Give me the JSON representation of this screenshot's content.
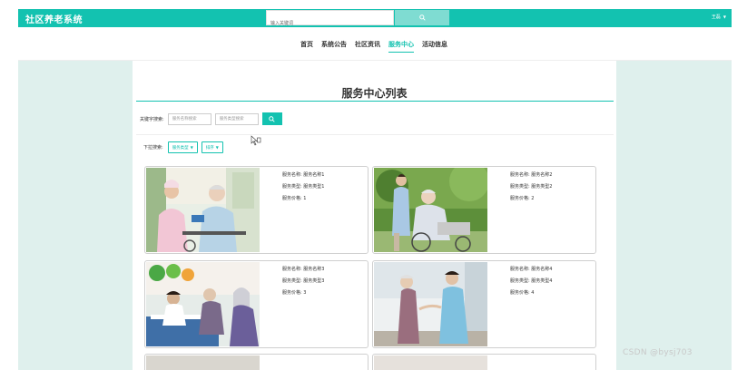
{
  "header": {
    "brand": "社区养老系统",
    "search_placeholder": "输入关键词",
    "user": "王磊"
  },
  "nav": {
    "items": [
      {
        "label": "首页"
      },
      {
        "label": "系统公告"
      },
      {
        "label": "社区资讯"
      },
      {
        "label": "服务中心"
      },
      {
        "label": "活动信息"
      }
    ],
    "active": "服务中心"
  },
  "page": {
    "title": "服务中心列表",
    "keyword_label": "关键字搜索:",
    "name_placeholder": "服务名称搜索",
    "type_placeholder": "服务类型搜索",
    "filter_label": "下拉搜索:",
    "filters": [
      {
        "label": "服务类型"
      },
      {
        "label": "排序"
      }
    ]
  },
  "cards": [
    {
      "name": "服务名称: 服务名称1",
      "type": "服务类型: 服务类型1",
      "price": "服务价格: 1",
      "image": "nurse-with-elderly-woman-photo"
    },
    {
      "name": "服务名称: 服务名称2",
      "type": "服务类型: 服务类型2",
      "price": "服务价格: 2",
      "image": "caregiver-pushing-wheelchair-photo"
    },
    {
      "name": "服务名称: 服务名称3",
      "type": "服务类型: 服务类型3",
      "price": "服务价格: 3",
      "image": "health-check-at-clinic-photo"
    },
    {
      "name": "服务名称: 服务名称4",
      "type": "服务类型: 服务类型4",
      "price": "服务价格: 4",
      "image": "nurse-helping-elderly-walk-photo"
    }
  ],
  "watermark": "CSDN @bysj703",
  "colors": {
    "accent": "#13c2b0",
    "side_panel": "#dff0ed"
  }
}
